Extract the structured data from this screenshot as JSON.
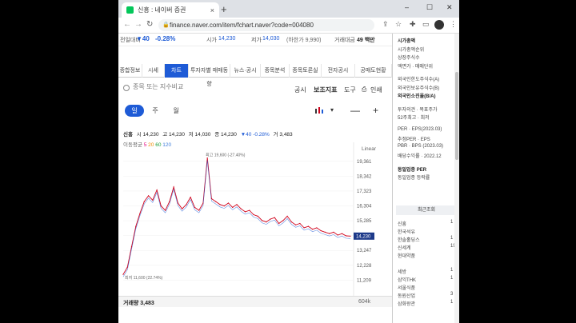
{
  "browser": {
    "tab_title": "신흥 : 네이버 증권",
    "tab_close": "×",
    "newtab": "+",
    "url": "finance.naver.com/item/fchart.naver?code=004080",
    "controls": {
      "min": "–",
      "max": "☐",
      "close": "✕"
    }
  },
  "stock_summary": {
    "prev_label": "전일대비",
    "change": "▼40",
    "change_pct": "-0.28%",
    "high_label": "시가",
    "open": "14,230",
    "low_label": "저가",
    "low": "14,030",
    "lower_limit": "(하한가 9,990)",
    "amount_label": "거래대금",
    "amount": "49 백만"
  },
  "main_tabs": [
    "종합정보",
    "시세",
    "차트",
    "투자자별 매매동향",
    "뉴스·공시",
    "종목분석",
    "종목토론실",
    "전자공시",
    "공매도현황"
  ],
  "active_tab": "차트",
  "search": {
    "placeholder": "종목 또는 지수비교",
    "links": [
      "공시",
      "보조지표",
      "도구"
    ],
    "print": "인쇄"
  },
  "periods": [
    "일",
    "주",
    "월"
  ],
  "active_period": "일",
  "zoom": {
    "minus": "—",
    "plus": "+"
  },
  "price_info": {
    "name": "신흥",
    "open": "시 14,230",
    "high": "고 14,230",
    "low": "저 14,030",
    "close": "종 14,230",
    "change": "▼40 -0.28%",
    "volume": "거 3,483"
  },
  "ma_info": {
    "label": "이동평균",
    "values": [
      "5",
      "20",
      "60",
      "120"
    ]
  },
  "chart_labels": {
    "scale": "Linear",
    "high_note": "최고 19,600 (-27.40%)",
    "low_note": "최저 11,600 (22.74%)",
    "current": "14,230",
    "volume_label": "거래량 3,483",
    "volume_axis": "604k"
  },
  "chart_data": {
    "type": "line",
    "y_ticks": [
      "19,361",
      "18,342",
      "17,323",
      "16,304",
      "15,285",
      "14,266",
      "13,247",
      "12,228",
      "11,209"
    ],
    "ylim": [
      10900,
      19900
    ],
    "values": [
      11600,
      12100,
      13500,
      14900,
      15800,
      16600,
      17000,
      16700,
      17400,
      16300,
      16000,
      16600,
      17600,
      16500,
      16100,
      16400,
      16900,
      16200,
      16000,
      16500,
      19600,
      16800,
      16600,
      16400,
      16300,
      16500,
      16200,
      16400,
      16100,
      15900,
      16000,
      15700,
      15600,
      15300,
      15200,
      15400,
      15500,
      15100,
      15300,
      15600,
      15200,
      15000,
      15100,
      14800,
      14900,
      14700,
      14800,
      14600,
      14500,
      14400,
      14500,
      14300,
      14400,
      14250,
      14230
    ]
  },
  "right_panel": {
    "items": [
      "시가총액",
      "시가총액순위",
      "상장주식수",
      "액면가 · 매매단위",
      "외국인한도주식수(A)",
      "외국인보유주식수(B)",
      "외국인소진율(B/A)",
      "투자의견 · 목표주가",
      "52주최고 · 최저",
      "PER · EPS(2023.03)",
      "추정PER · EPS",
      "PBR · BPS (2023.03)",
      "배당수익률 · 2022.12",
      "동일업종 PER",
      "동일업종 등락률"
    ],
    "recent_title": "최근조회",
    "recent": [
      {
        "name": "신흥",
        "n": "1"
      },
      {
        "name": "한국석유",
        "n": ""
      },
      {
        "name": "한솔홀딩스",
        "n": "1"
      },
      {
        "name": "신세계",
        "n": "19"
      },
      {
        "name": "현대약품",
        "n": ""
      },
      {
        "name": "세방",
        "n": "1"
      },
      {
        "name": "삼익THK",
        "n": "1"
      },
      {
        "name": "서울식품",
        "n": ""
      },
      {
        "name": "동원산업",
        "n": "3"
      },
      {
        "name": "삼화왕관",
        "n": "1"
      }
    ]
  }
}
